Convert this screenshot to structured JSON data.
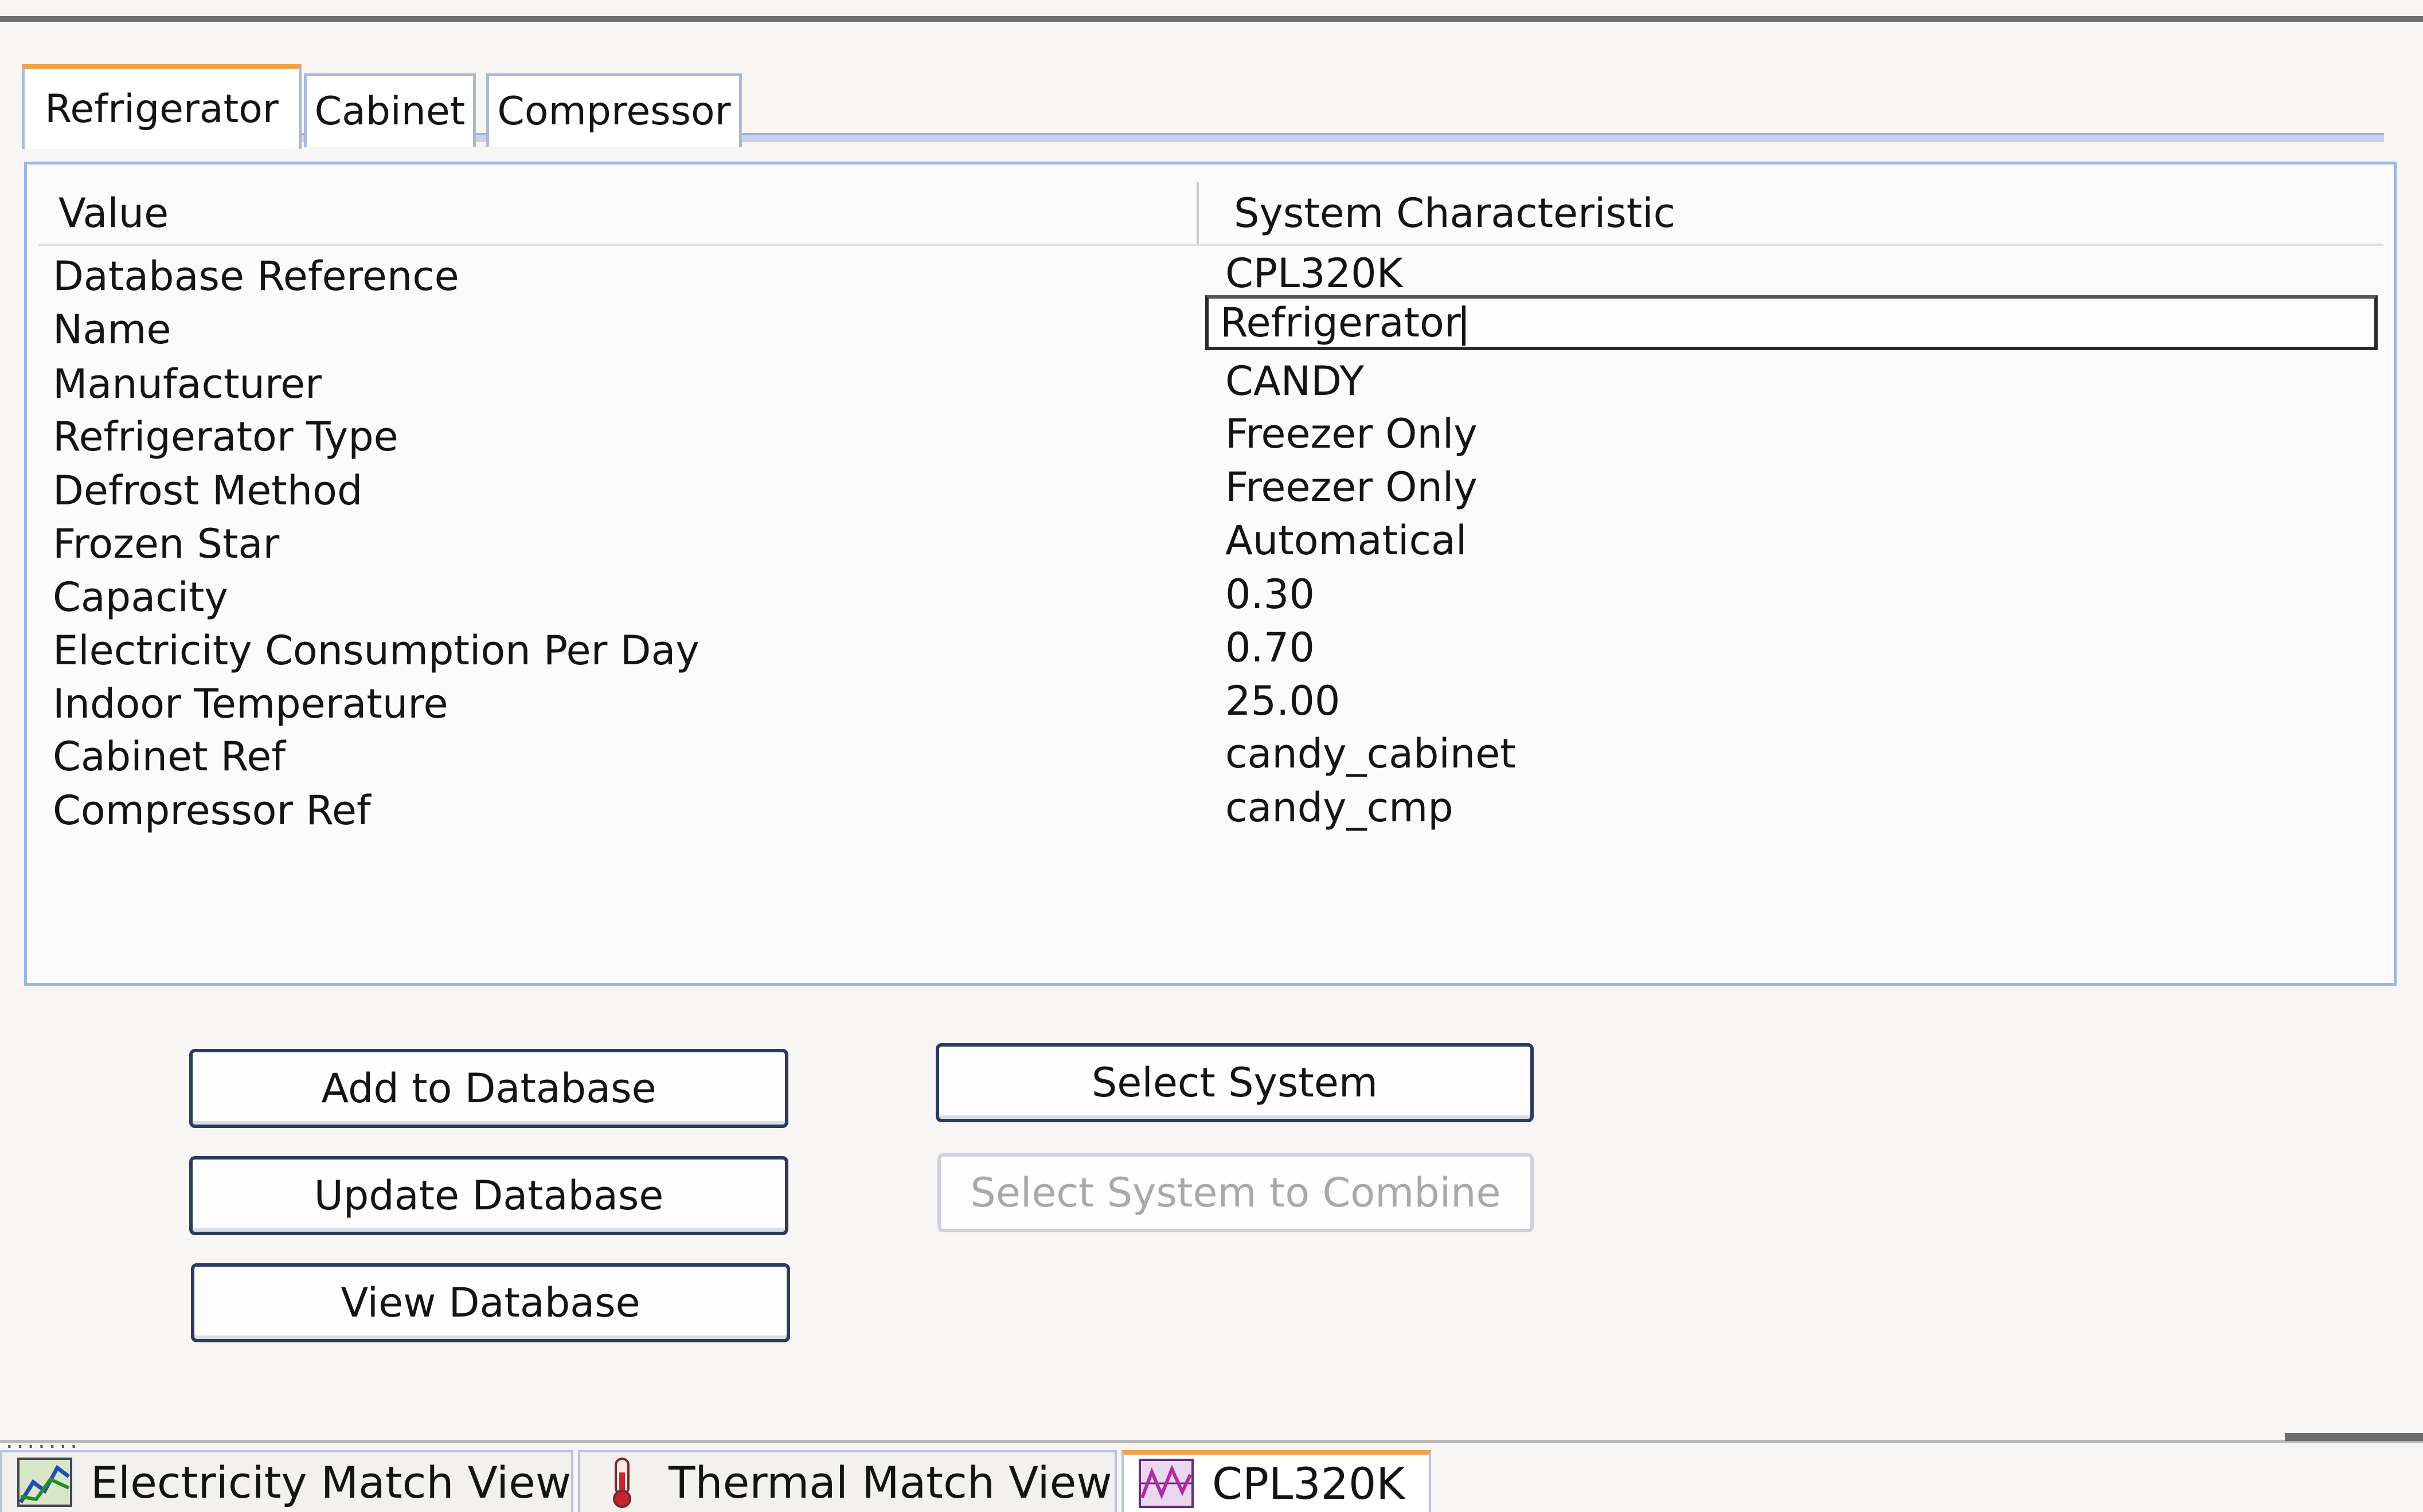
{
  "tabs": [
    {
      "label": "Refrigerator",
      "active": true
    },
    {
      "label": "Cabinet",
      "active": false
    },
    {
      "label": "Compressor",
      "active": false
    }
  ],
  "grid": {
    "header_value": "Value",
    "header_characteristic": "System Characteristic",
    "rows": [
      {
        "label": "Database Reference",
        "value": "CPL320K"
      },
      {
        "label": "Name",
        "value": "Refrigerator"
      },
      {
        "label": "Manufacturer",
        "value": "CANDY"
      },
      {
        "label": "Refrigerator Type",
        "value": "Freezer Only"
      },
      {
        "label": "Defrost Method",
        "value": "Freezer Only"
      },
      {
        "label": "Frozen Star",
        "value": "Automatical"
      },
      {
        "label": "Capacity",
        "value": "0.30"
      },
      {
        "label": "Electricity Consumption Per Day",
        "value": "0.70"
      },
      {
        "label": "Indoor Temperature",
        "value": "25.00"
      },
      {
        "label": "Cabinet Ref",
        "value": "candy_cabinet"
      },
      {
        "label": "Compressor Ref",
        "value": "candy_cmp"
      }
    ]
  },
  "buttons": {
    "add_to_database": "Add to Database",
    "update_database": "Update Database",
    "view_database": "View Database",
    "select_system": "Select System",
    "select_system_to_combine": "Select System to Combine"
  },
  "bottom_tabs": [
    {
      "label": "Electricity Match View (e)",
      "icon": "chart-icon",
      "active": false
    },
    {
      "label": "Thermal Match View (t)",
      "icon": "thermometer-icon",
      "active": false
    },
    {
      "label": "CPL320K",
      "icon": "refrigerator-chart-icon",
      "active": true
    }
  ],
  "colors": {
    "accent_tab": "#f0a24a",
    "panel_border": "#9eb6e0",
    "button_border": "#2c3a5c",
    "disabled_text": "#a9a9a9"
  }
}
